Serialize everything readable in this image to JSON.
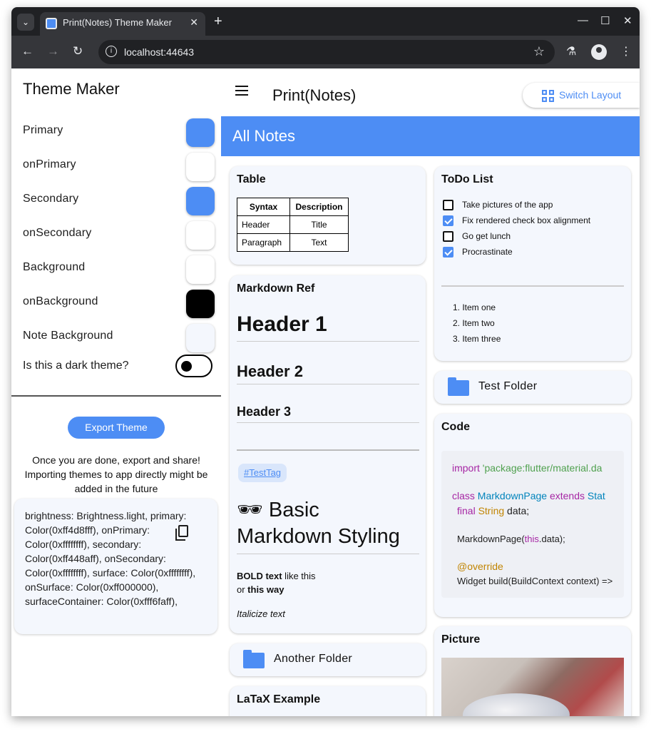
{
  "browser": {
    "tab_title": "Print(Notes) Theme Maker",
    "url": "localhost:44643",
    "tab_close": "✕",
    "new_tab": "+",
    "icons": {
      "back": "←",
      "forward": "→",
      "reload": "↻",
      "star": "☆",
      "labs": "⚗",
      "menu": "⋮",
      "minimize": "—",
      "maximize": "☐",
      "close": "✕",
      "tab_search": "⌄",
      "info": "i"
    }
  },
  "sidebar": {
    "title": "Theme Maker",
    "colors": [
      {
        "label": "Primary",
        "color": "#4d8df4"
      },
      {
        "label": "onPrimary",
        "color": "#ffffff"
      },
      {
        "label": "Secondary",
        "color": "#4d8df4"
      },
      {
        "label": "onSecondary",
        "color": "#ffffff"
      },
      {
        "label": "Background",
        "color": "#ffffff"
      },
      {
        "label": "onBackground",
        "color": "#000000"
      },
      {
        "label": "Note Background",
        "color": "#f4f7fd"
      }
    ],
    "dark_toggle_label": "Is this a dark theme?",
    "dark_toggle_on": false,
    "export_button": "Export Theme",
    "export_note": "Once you are done, export and share! Importing themes to app directly might be added in the future",
    "theme_text": "brightness: Brightness.light, primary: Color(0xff4d8fff), onPrimary: Color(0xffffffff), secondary: Color(0xff448aff), onSecondary: Color(0xffffffff), surface: Color(0xffffffff), onSurface: Color(0xff000000), surfaceContainer: Color(0xfff6faff),"
  },
  "main": {
    "app_title": "Print(Notes)",
    "switch_layout": "Switch Layout",
    "banner_title": "All Notes",
    "table_card": {
      "title": "Table",
      "headers": [
        "Syntax",
        "Description"
      ],
      "rows": [
        [
          "Header",
          "Title"
        ],
        [
          "Paragraph",
          "Text"
        ]
      ]
    },
    "markdown_card": {
      "title": "Markdown Ref",
      "h1": "Header 1",
      "h2": "Header 2",
      "h3": "Header 3",
      "tag": "#TestTag",
      "emoji": "🕶",
      "big_heading": "Basic Markdown Styling",
      "bold_line1_bold": "BOLD text",
      "bold_line1_rest": " like this",
      "bold_line2_pre": "or ",
      "bold_line2_bold": "this way",
      "italic": "Italicize text"
    },
    "folder_another": "Another Folder",
    "latex_title": "LaTaX Example",
    "todo_card": {
      "title": "ToDo List",
      "items": [
        {
          "text": "Take pictures of the app",
          "checked": false
        },
        {
          "text": "Fix rendered check box alignment",
          "checked": true
        },
        {
          "text": "Go get lunch",
          "checked": false
        },
        {
          "text": "Procrastinate",
          "checked": true
        }
      ],
      "ordered": [
        "Item one",
        "Item two",
        "Item three"
      ]
    },
    "folder_test": "Test Folder",
    "code_card": {
      "title": "Code",
      "l1_kw": "import",
      "l1_str": " 'package:flutter/material.da",
      "l2_kw": "class",
      "l2_ty": " MarkdownPage",
      "l2_kw2": " extends",
      "l2_ty2": " Stat",
      "l3_kw": "final",
      "l3_ty": " String",
      "l3_rest": " data;",
      "l4_pre": "MarkdownPage(",
      "l4_kw": "this",
      "l4_rest": ".data);",
      "l5_ann": "@override",
      "l6": "Widget build(BuildContext context) =>"
    },
    "picture_title": "Picture"
  }
}
